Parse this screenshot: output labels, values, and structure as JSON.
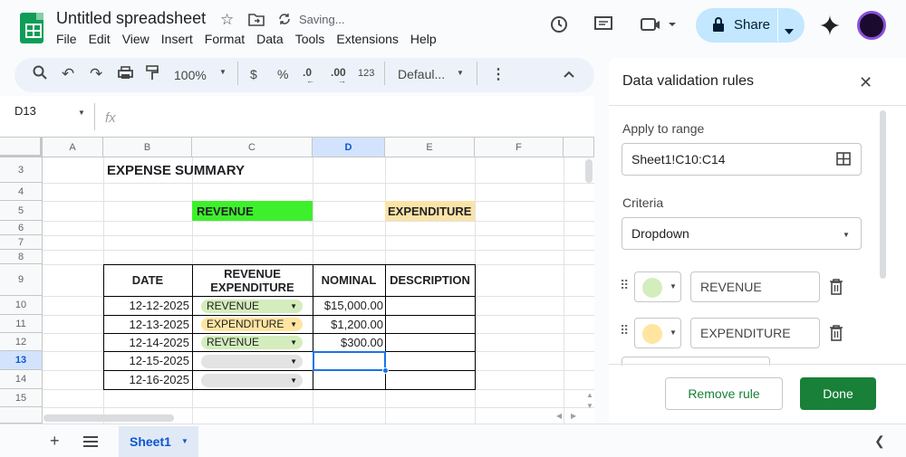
{
  "header": {
    "title": "Untitled spreadsheet",
    "saving": "Saving...",
    "menu": [
      "File",
      "Edit",
      "View",
      "Insert",
      "Format",
      "Data",
      "Tools",
      "Extensions",
      "Help"
    ],
    "share_label": "Share"
  },
  "toolbar": {
    "zoom": "100%",
    "currency": "$",
    "percent": "%",
    "dec_decrease": ".0",
    "dec_increase": ".00",
    "number_format": "123",
    "font": "Defaul..."
  },
  "formula_bar": {
    "name_box": "D13",
    "fx": "fx"
  },
  "columns": [
    "A",
    "B",
    "C",
    "D",
    "E",
    "F"
  ],
  "rows": [
    "3",
    "4",
    "5",
    "6",
    "7",
    "8",
    "9",
    "10",
    "11",
    "12",
    "13",
    "14",
    "15"
  ],
  "sheet": {
    "title": "EXPENSE SUMMARY",
    "revenue_label": "REVENUE",
    "expenditure_label": "EXPENDITURE",
    "table_headers": [
      "DATE",
      "REVENUE\nEXPENDITURE",
      "NOMINAL",
      "DESCRIPTION"
    ],
    "table_rows": [
      {
        "date": "12-12-2025",
        "type": "REVENUE",
        "nominal": "$15,000.00",
        "description": ""
      },
      {
        "date": "12-13-2025",
        "type": "EXPENDITURE",
        "nominal": "$1,200.00",
        "description": ""
      },
      {
        "date": "12-14-2025",
        "type": "REVENUE",
        "nominal": "$300.00",
        "description": ""
      },
      {
        "date": "12-15-2025",
        "type": "",
        "nominal": "",
        "description": ""
      },
      {
        "date": "12-16-2025",
        "type": "",
        "nominal": "",
        "description": ""
      }
    ]
  },
  "panel": {
    "title": "Data validation rules",
    "apply_label": "Apply to range",
    "range": "Sheet1!C10:C14",
    "criteria_label": "Criteria",
    "criteria_value": "Dropdown",
    "options": [
      {
        "value": "REVENUE",
        "color": "#d4edbc"
      },
      {
        "value": "EXPENDITURE",
        "color": "#ffe5a0"
      }
    ],
    "remove_label": "Remove rule",
    "done_label": "Done"
  },
  "footer": {
    "sheet_tab": "Sheet1"
  },
  "colors": {
    "revenue_fill": "#3ef02c",
    "expenditure_fill": "#fbe3a8",
    "chip_revenue": "#d4edbc",
    "chip_expenditure": "#ffe5a0",
    "selection": "#1a73e8",
    "done_button": "#188038"
  }
}
